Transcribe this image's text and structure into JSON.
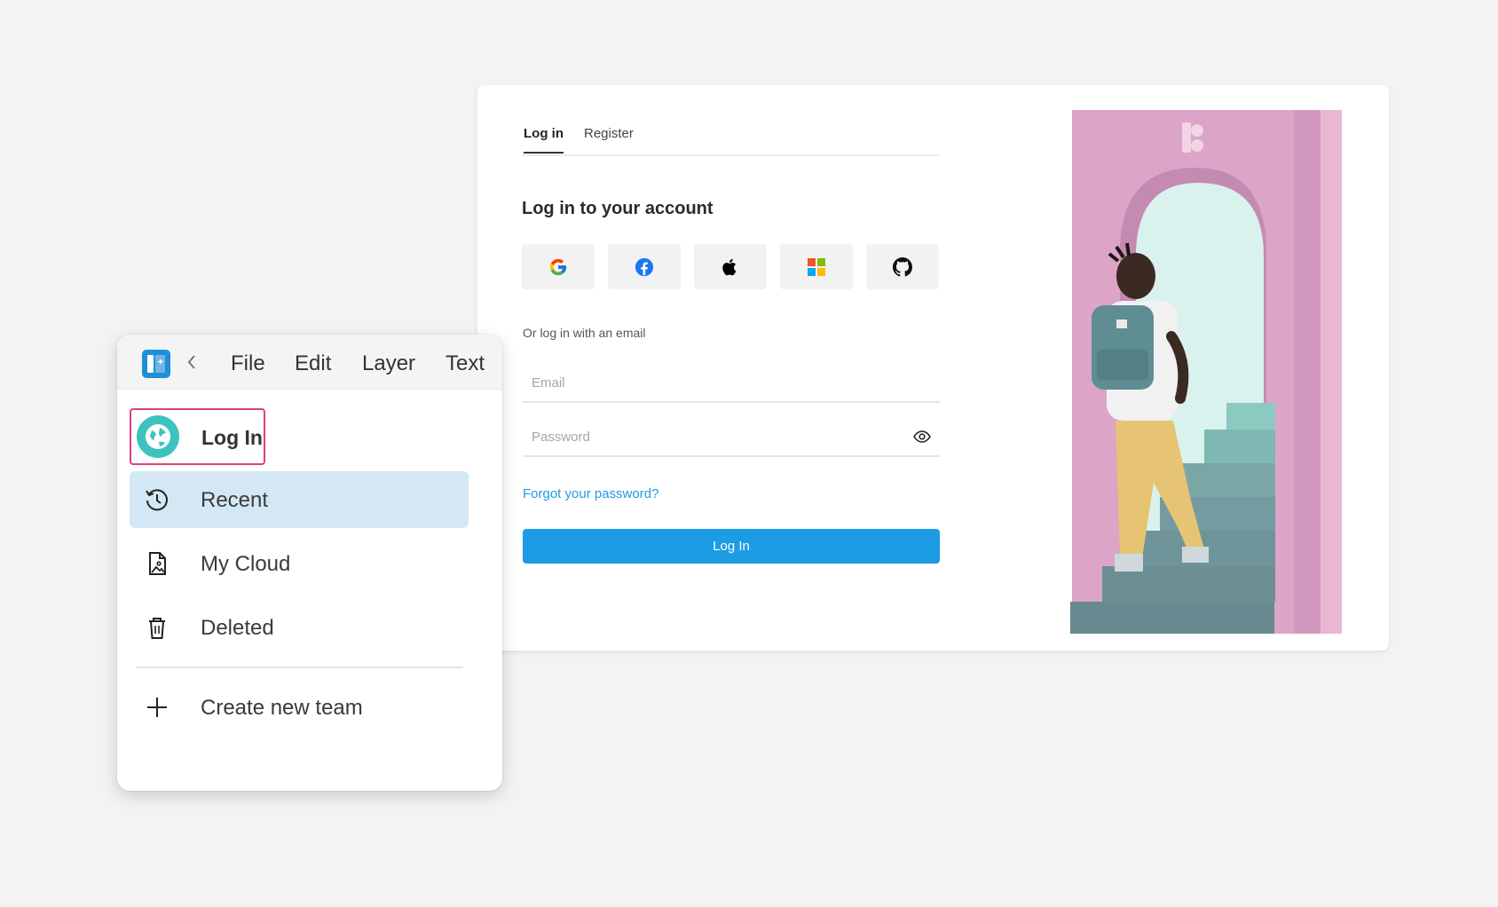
{
  "login_card": {
    "tabs": [
      {
        "label": "Log in"
      },
      {
        "label": "Register"
      }
    ],
    "heading": "Log in to your account",
    "social_buttons": [
      {
        "icon": "google-icon"
      },
      {
        "icon": "facebook-icon"
      },
      {
        "icon": "apple-icon"
      },
      {
        "icon": "microsoft-icon"
      },
      {
        "icon": "github-icon"
      }
    ],
    "or_text": "Or log in with an email",
    "email": {
      "placeholder": "Email",
      "value": ""
    },
    "password": {
      "placeholder": "Password",
      "value": ""
    },
    "forgot_link": "Forgot your password?",
    "submit_label": "Log In",
    "colors": {
      "accent": "#1b9ce4",
      "link": "#1d9be2"
    }
  },
  "menu_panel": {
    "menu_bar": [
      "File",
      "Edit",
      "Layer",
      "Text"
    ],
    "login_label": "Log In",
    "nav": {
      "recent": "Recent",
      "my_cloud": "My Cloud",
      "deleted": "Deleted",
      "create_team": "Create new team"
    },
    "colors": {
      "highlight_border": "#e0407f",
      "active_bg": "#d3e8f4",
      "globe": "#3cc3bd"
    }
  }
}
